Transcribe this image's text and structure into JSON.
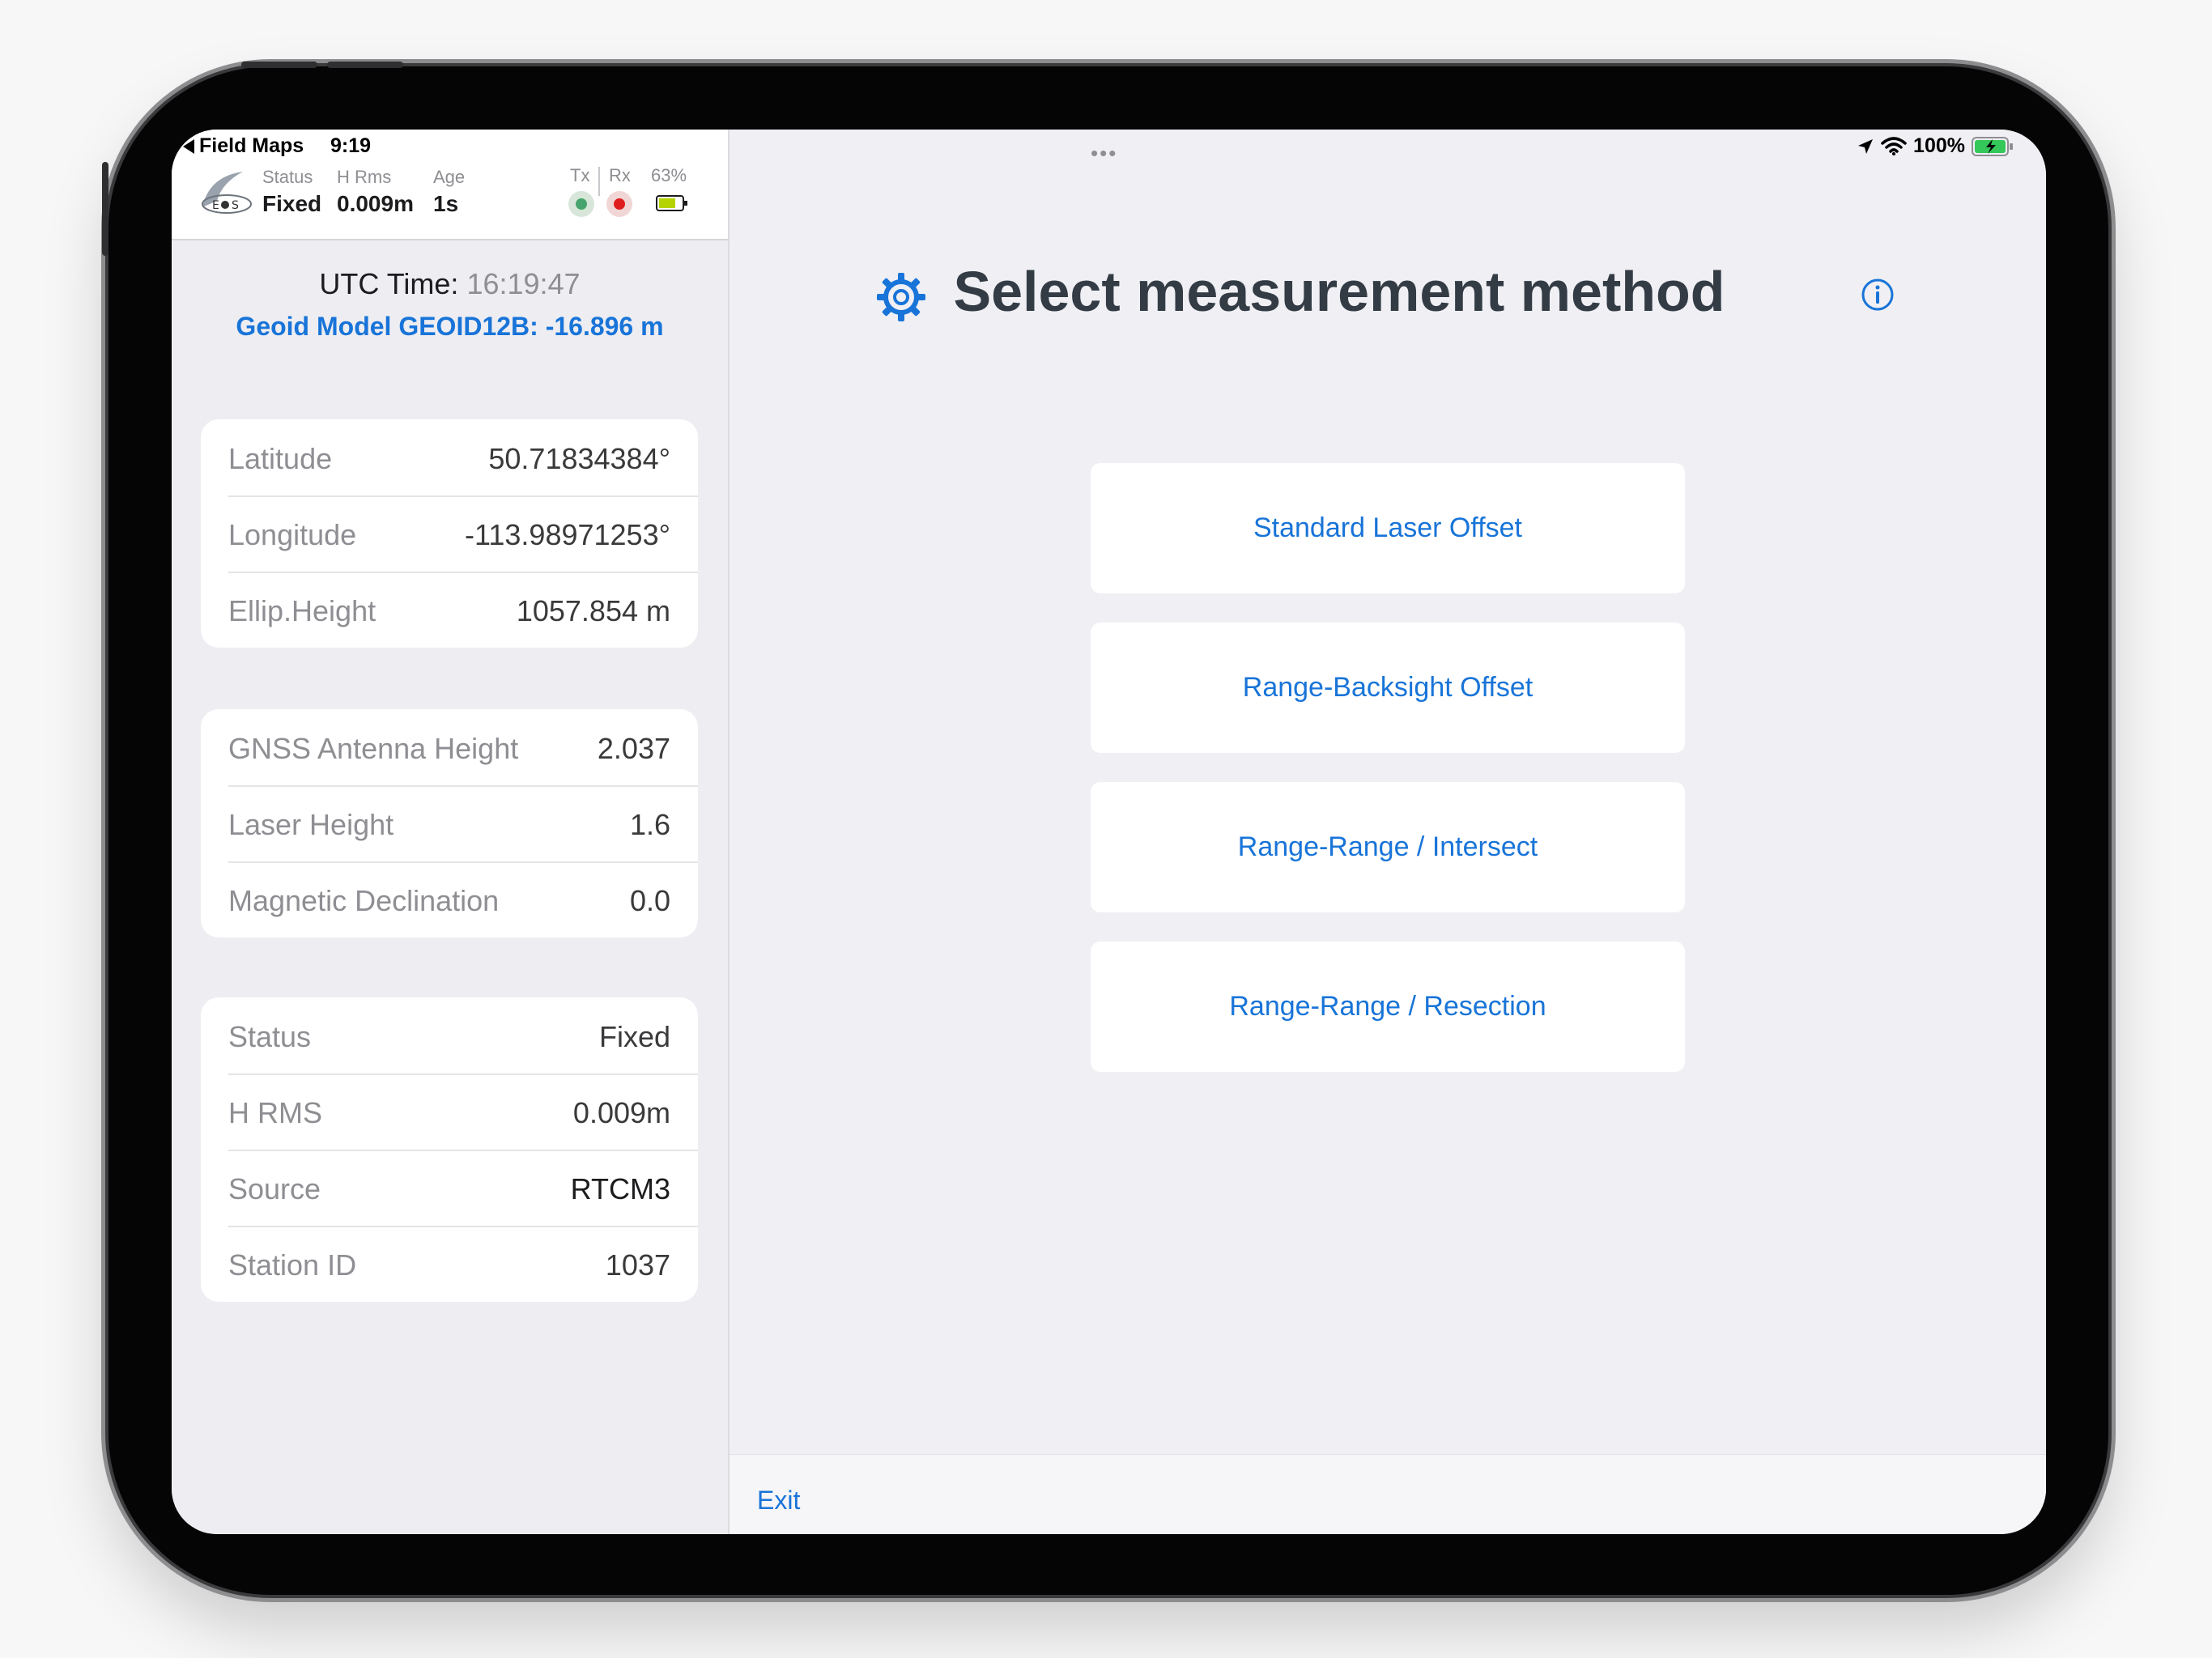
{
  "status_bar": {
    "back_app": "Field Maps",
    "time": "9:19",
    "battery_pct": "100%"
  },
  "receiver": {
    "status_label": "Status",
    "status_value": "Fixed",
    "hrms_label": "H Rms",
    "hrms_value": "0.009m",
    "age_label": "Age",
    "age_value": "1s",
    "tx_label": "Tx",
    "rx_label": "Rx",
    "battery_label": "63%"
  },
  "utc": {
    "label": "UTC Time:",
    "time": "16:19:47"
  },
  "geoid": "Geoid Model GEOID12B: -16.896 m",
  "position_card": [
    {
      "key": "Latitude",
      "value": "50.71834384°"
    },
    {
      "key": "Longitude",
      "value": "-113.98971253°"
    },
    {
      "key": "Ellip.Height",
      "value": "1057.854 m"
    }
  ],
  "height_card": [
    {
      "key": "GNSS Antenna Height",
      "value": "2.037"
    },
    {
      "key": "Laser Height",
      "value": "1.6"
    },
    {
      "key": "Magnetic Declination",
      "value": "0.0"
    }
  ],
  "info_card": [
    {
      "key": "Status",
      "value": "Fixed"
    },
    {
      "key": "H RMS",
      "value": "0.009m"
    },
    {
      "key": "Source",
      "value": "RTCM3"
    },
    {
      "key": "Station ID",
      "value": "1037"
    }
  ],
  "main": {
    "title": "Select measurement method",
    "methods": [
      "Standard Laser Offset",
      "Range-Backsight Offset",
      "Range-Range / Intersect",
      "Range-Range / Resection"
    ],
    "exit_label": "Exit"
  },
  "colors": {
    "accent": "#1874d8",
    "title": "#333c45",
    "tx_led": "#46a46c",
    "rx_led": "#e01d1d"
  },
  "icons": [
    "back-arrow-icon",
    "eos-logo-icon",
    "battery-icon",
    "location-arrow-icon",
    "wifi-icon",
    "gear-icon",
    "info-icon"
  ]
}
